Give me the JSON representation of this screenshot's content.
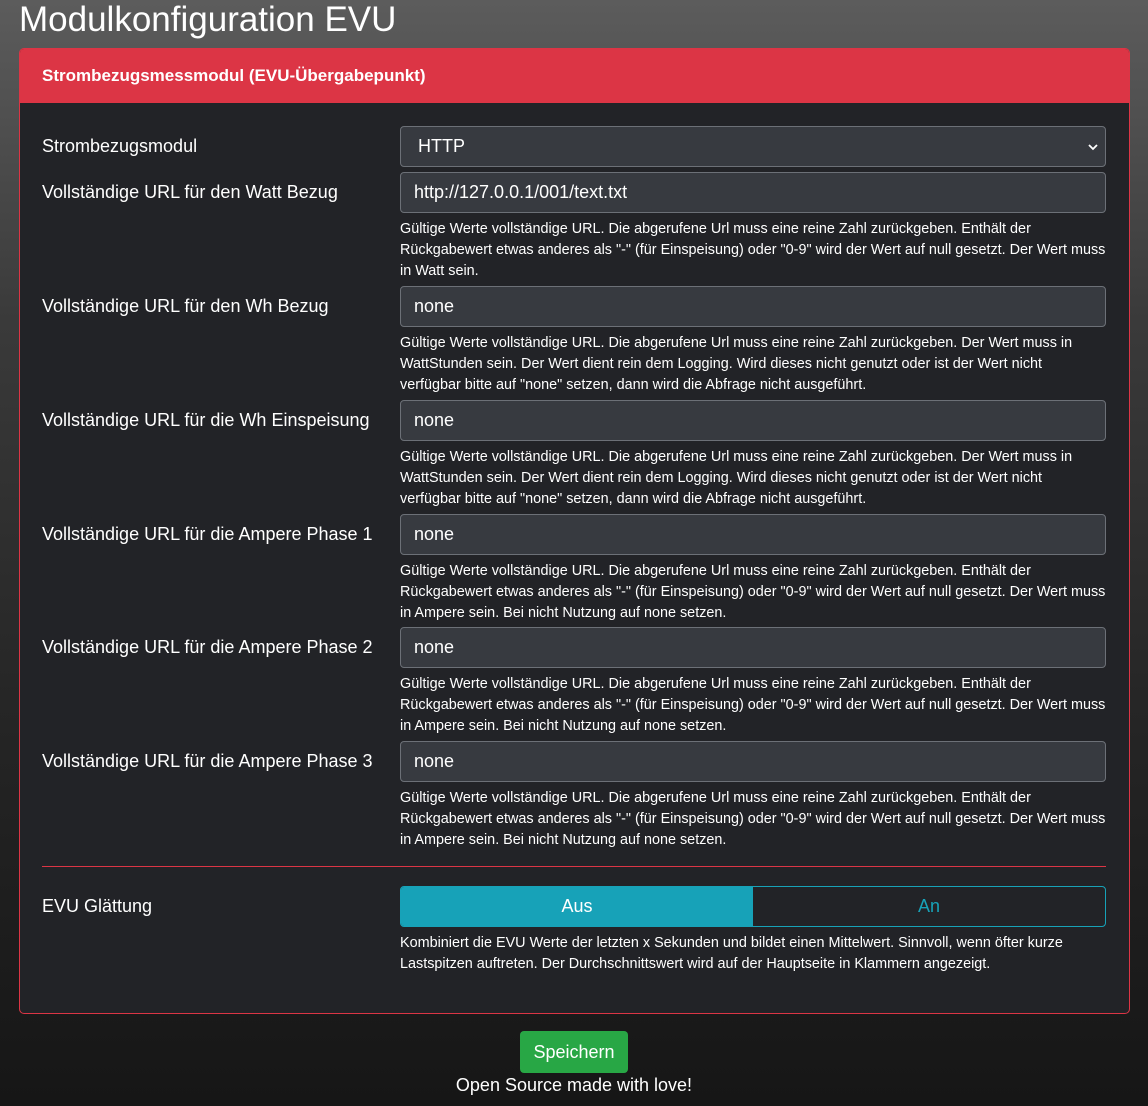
{
  "page": {
    "title": "Modulkonfiguration EVU"
  },
  "card": {
    "header": "Strombezugsmessmodul (EVU-Übergabepunkt)"
  },
  "fields": [
    {
      "label": "Strombezugsmodul",
      "type": "select",
      "value": "HTTP",
      "help": ""
    },
    {
      "label": "Vollständige URL für den Watt Bezug",
      "type": "input",
      "value": "http://127.0.0.1/001/text.txt",
      "help": "Gültige Werte vollständige URL. Die abgerufene Url muss eine reine Zahl zurückgeben. Enthält der Rückgabewert etwas anderes als \"-\" (für Einspeisung) oder \"0-9\" wird der Wert auf null gesetzt. Der Wert muss in Watt sein."
    },
    {
      "label": "Vollständige URL für den Wh Bezug",
      "type": "input",
      "value": "none",
      "help": "Gültige Werte vollständige URL. Die abgerufene Url muss eine reine Zahl zurückgeben. Der Wert muss in WattStunden sein. Der Wert dient rein dem Logging. Wird dieses nicht genutzt oder ist der Wert nicht verfügbar bitte auf \"none\" setzen, dann wird die Abfrage nicht ausgeführt."
    },
    {
      "label": "Vollständige URL für die Wh Einspeisung",
      "type": "input",
      "value": "none",
      "help": "Gültige Werte vollständige URL. Die abgerufene Url muss eine reine Zahl zurückgeben. Der Wert muss in WattStunden sein. Der Wert dient rein dem Logging. Wird dieses nicht genutzt oder ist der Wert nicht verfügbar bitte auf \"none\" setzen, dann wird die Abfrage nicht ausgeführt."
    },
    {
      "label": "Vollständige URL für die Ampere Phase 1",
      "type": "input",
      "value": "none",
      "help": "Gültige Werte vollständige URL. Die abgerufene Url muss eine reine Zahl zurückgeben. Enthält der Rückgabewert etwas anderes als \"-\" (für Einspeisung) oder \"0-9\" wird der Wert auf null gesetzt. Der Wert muss in Ampere sein. Bei nicht Nutzung auf none setzen."
    },
    {
      "label": "Vollständige URL für die Ampere Phase 2",
      "type": "input",
      "value": "none",
      "help": "Gültige Werte vollständige URL. Die abgerufene Url muss eine reine Zahl zurückgeben. Enthält der Rückgabewert etwas anderes als \"-\" (für Einspeisung) oder \"0-9\" wird der Wert auf null gesetzt. Der Wert muss in Ampere sein. Bei nicht Nutzung auf none setzen."
    },
    {
      "label": "Vollständige URL für die Ampere Phase 3",
      "type": "input",
      "value": "none",
      "help": "Gültige Werte vollständige URL. Die abgerufene Url muss eine reine Zahl zurückgeben. Enthält der Rückgabewert etwas anderes als \"-\" (für Einspeisung) oder \"0-9\" wird der Wert auf null gesetzt. Der Wert muss in Ampere sein. Bei nicht Nutzung auf none setzen."
    }
  ],
  "smoothing": {
    "label": "EVU Glättung",
    "off_label": "Aus",
    "on_label": "An",
    "selected": "Aus",
    "help": "Kombiniert die EVU Werte der letzten x Sekunden und bildet einen Mittelwert. Sinnvoll, wenn öfter kurze Lastspitzen auftreten. Der Durchschnittswert wird auf der Hauptseite in Klammern angezeigt."
  },
  "actions": {
    "save_label": "Speichern"
  },
  "footer": {
    "text": "Open Source made with love!"
  },
  "colors": {
    "header_bg": "#dc3545",
    "card_bg": "#222327",
    "input_bg": "#373a40",
    "toggle_accent": "#17a2b8",
    "save_bg": "#28a745"
  }
}
